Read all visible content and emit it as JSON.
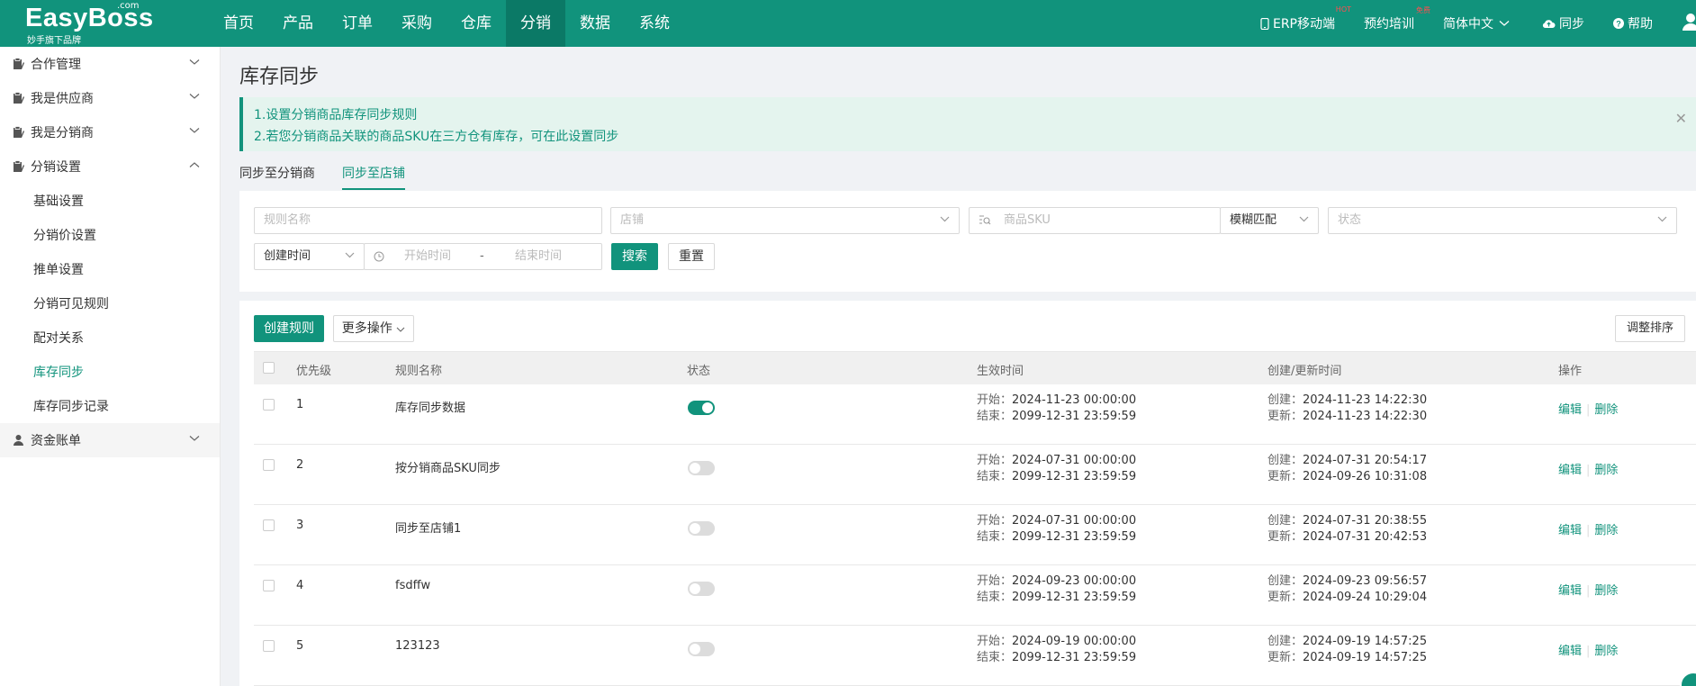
{
  "header": {
    "brand": "EasyBoss",
    "brand_com": ".com",
    "brand_sub": "妙手旗下品牌",
    "nav": [
      "首页",
      "产品",
      "订单",
      "采购",
      "仓库",
      "分销",
      "数据",
      "系统"
    ],
    "erp_mobile": "ERP移动端",
    "erp_mobile_badge": "HOT",
    "training": "预约培训",
    "training_badge": "免费",
    "language": "简体中文",
    "sync": "同步",
    "help": "帮助"
  },
  "sidebar": {
    "groups": [
      "合作管理",
      "我是供应商",
      "我是分销商",
      "分销设置"
    ],
    "sub_items": [
      "基础设置",
      "分销价设置",
      "推单设置",
      "分销可见规则",
      "配对关系",
      "库存同步",
      "库存同步记录"
    ],
    "last_group": "资金账单"
  },
  "page": {
    "title": "库存同步",
    "notice_line1": "1.设置分销商品库存同步规则",
    "notice_line2": "2.若您分销商品关联的商品SKU在三方仓有库存，可在此设置同步",
    "tabs": [
      "同步至分销商",
      "同步至店铺"
    ]
  },
  "filter": {
    "rule_name_placeholder": "规则名称",
    "shop_placeholder": "店铺",
    "sku_placeholder": "商品SKU",
    "match_mode": "模糊匹配",
    "status_placeholder": "状态",
    "time_type": "创建时间",
    "start_placeholder": "开始时间",
    "range_sep": "-",
    "end_placeholder": "结束时间",
    "search": "搜索",
    "reset": "重置"
  },
  "toolbar": {
    "create": "创建规则",
    "more": "更多操作",
    "adjust_order": "调整排序"
  },
  "table": {
    "columns": [
      "优先级",
      "规则名称",
      "状态",
      "生效时间",
      "创建/更新时间",
      "操作"
    ],
    "start_label": "开始：",
    "end_label": "结束：",
    "created_label": "创建：",
    "updated_label": "更新：",
    "edit": "编辑",
    "delete": "删除",
    "rows": [
      {
        "priority": "1",
        "name": "库存同步数据",
        "enabled": true,
        "start": "2024-11-23 00:00:00",
        "end": "2099-12-31 23:59:59",
        "created": "2024-11-23 14:22:30",
        "updated": "2024-11-23 14:22:30"
      },
      {
        "priority": "2",
        "name": "按分销商品SKU同步",
        "enabled": false,
        "start": "2024-07-31 00:00:00",
        "end": "2099-12-31 23:59:59",
        "created": "2024-07-31 20:54:17",
        "updated": "2024-09-26 10:31:08"
      },
      {
        "priority": "3",
        "name": "同步至店铺1",
        "enabled": false,
        "start": "2024-07-31 00:00:00",
        "end": "2099-12-31 23:59:59",
        "created": "2024-07-31 20:38:55",
        "updated": "2024-07-31 20:42:53"
      },
      {
        "priority": "4",
        "name": "fsdffw",
        "enabled": false,
        "start": "2024-09-23 00:00:00",
        "end": "2099-12-31 23:59:59",
        "created": "2024-09-23 09:56:57",
        "updated": "2024-09-24 10:29:04"
      },
      {
        "priority": "5",
        "name": "123123",
        "enabled": false,
        "start": "2024-09-19 00:00:00",
        "end": "2099-12-31 23:59:59",
        "created": "2024-09-19 14:57:25",
        "updated": "2024-09-19 14:57:25"
      }
    ]
  }
}
